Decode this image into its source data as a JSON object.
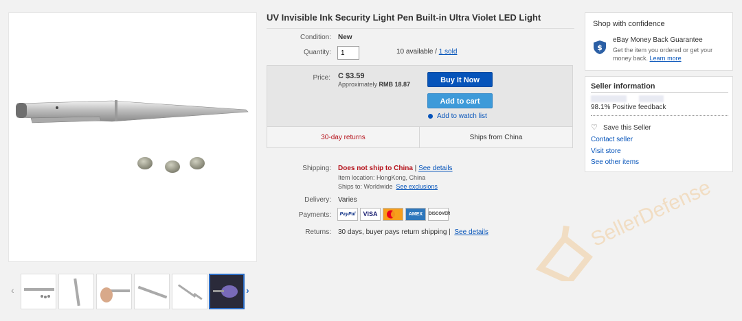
{
  "product": {
    "title": "UV Invisible Ink Security Light Pen Built-in Ultra Violet LED Light",
    "condition_label": "Condition:",
    "condition_value": "New",
    "quantity_label": "Quantity:",
    "quantity_value": "1",
    "available_text": "10 available /",
    "sold_link": "1 sold"
  },
  "buy_box": {
    "price_label": "Price:",
    "price": "C $3.59",
    "approx_label": "Approximately",
    "approx_value": "RMB 18.87",
    "buy_now": "Buy It Now",
    "add_to_cart": "Add to cart",
    "watch": "Add to watch list",
    "returns": "30-day returns",
    "ships_from": "Ships from China"
  },
  "details": {
    "shipping_label": "Shipping:",
    "shipping_value": "Does not ship to China",
    "shipping_link": "See details",
    "item_location": "Item location:  HongKong, China",
    "ships_to": "Ships to: Worldwide",
    "exclusions_link": "See exclusions",
    "delivery_label": "Delivery:",
    "delivery_value": "Varies",
    "payments_label": "Payments:",
    "payments": [
      "PayPal",
      "VISA",
      "MC",
      "AMEX",
      "DISCOVER"
    ],
    "returns_label": "Returns:",
    "returns_value": "30 days, buyer pays return shipping |",
    "returns_link": "See details"
  },
  "confidence": {
    "title": "Shop with confidence",
    "guarantee_title": "eBay Money Back Guarantee",
    "guarantee_text": "Get the item you ordered or get your money back.",
    "learn_more": "Learn more"
  },
  "seller": {
    "title": "Seller information",
    "feedback": "98.1% Positive feedback",
    "save": "Save this Seller",
    "contact": "Contact seller",
    "visit": "Visit store",
    "other": "See other items"
  },
  "watermark": "SellerDefense",
  "colors": {
    "link": "#0654ba",
    "buy_now": "#0654ba",
    "add_to_cart": "#3d9ad9",
    "returns_red": "#b5121b",
    "watermark": "#f0a33a"
  }
}
